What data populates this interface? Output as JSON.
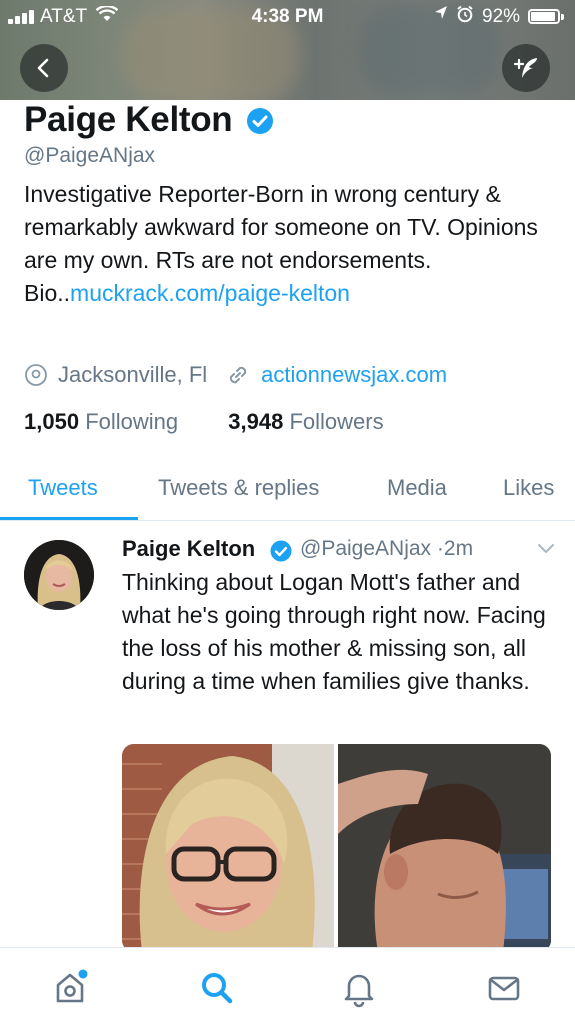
{
  "status_bar": {
    "carrier": "AT&T",
    "time": "4:38 PM",
    "battery": "92%",
    "battery_level": 0.92,
    "icons": [
      "signal-icon",
      "wifi-icon",
      "location-icon",
      "alarm-icon",
      "battery-icon"
    ]
  },
  "header": {
    "back_icon": "chevron-left-icon",
    "compose_icon": "compose-tweet-icon"
  },
  "profile": {
    "name": "Paige Kelton",
    "handle": "@PaigeANjax",
    "bio_text": "Investigative Reporter-Born in wrong century & remarkably awkward for someone on TV. Opinions are my own. RTs are not endorsements. Bio..",
    "bio_link": "muckrack.com/paige-kelton",
    "location": "Jacksonville, Fl",
    "website": "actionnewsjax.com",
    "following_count": "1,050",
    "following_label": "Following",
    "followers_count": "3,948",
    "followers_label": "Followers"
  },
  "tabs": [
    {
      "label": "Tweets",
      "active": true
    },
    {
      "label": "Tweets & replies",
      "active": false
    },
    {
      "label": "Media",
      "active": false
    },
    {
      "label": "Likes",
      "active": false
    }
  ],
  "tweet": {
    "author": "Paige Kelton",
    "handle": "@PaigeANjax",
    "separator": "·",
    "age": "2m",
    "text": "Thinking about Logan Mott's father and what he's going through right now.  Facing the loss of his mother & missing son, all during a time when families give thanks."
  },
  "bottom_nav": [
    {
      "name": "home",
      "icon": "home-icon",
      "badge": true
    },
    {
      "name": "search",
      "icon": "search-icon",
      "active": true
    },
    {
      "name": "notifications",
      "icon": "bell-icon"
    },
    {
      "name": "messages",
      "icon": "envelope-icon"
    }
  ],
  "colors": {
    "accent": "#1da1f2",
    "text": "#14171a",
    "muted": "#657786",
    "divider": "#e1e8ed"
  }
}
